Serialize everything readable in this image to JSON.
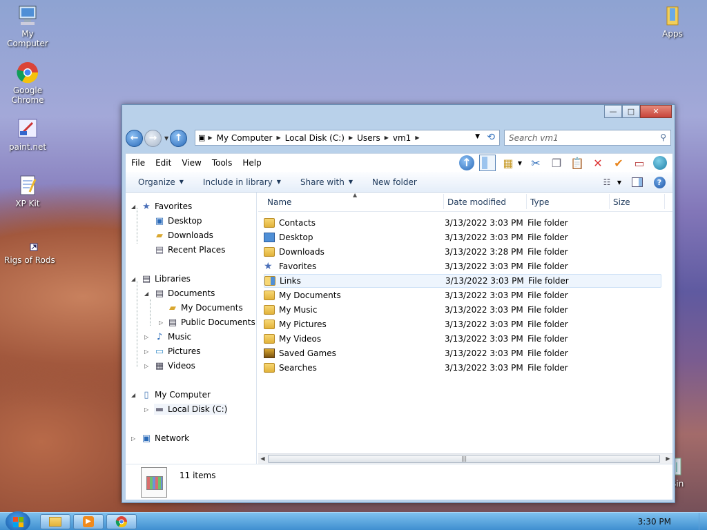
{
  "desktop": {
    "icons": [
      {
        "label": "My Computer",
        "icon": "computer-icon"
      },
      {
        "label": "Google Chrome",
        "icon": "chrome-icon"
      },
      {
        "label": "paint.net",
        "icon": "paintnet-icon"
      },
      {
        "label": "XP Kit",
        "icon": "document-icon"
      },
      {
        "label": "Rigs of Rods",
        "icon": "shortcut-icon"
      },
      {
        "label": "Apps",
        "icon": "folder-icon"
      },
      {
        "label": "e Bin",
        "icon": "recycle-bin-icon"
      }
    ]
  },
  "window": {
    "caption": {
      "minimize": "—",
      "maximize": "□",
      "close": "✕"
    },
    "address": {
      "crumbs": [
        "My Computer",
        "Local Disk (C:)",
        "Users",
        "vm1"
      ]
    },
    "search": {
      "placeholder": "Search vm1"
    },
    "menu": [
      "File",
      "Edit",
      "View",
      "Tools",
      "Help"
    ],
    "commands": {
      "organize": "Organize",
      "include_in_library": "Include in library",
      "share_with": "Share with",
      "new_folder": "New folder"
    },
    "nav_tree": {
      "favorites": "Favorites",
      "desktop": "Desktop",
      "downloads": "Downloads",
      "recent_places": "Recent Places",
      "libraries": "Libraries",
      "documents": "Documents",
      "my_documents": "My Documents",
      "public_documents": "Public Documents",
      "music": "Music",
      "pictures": "Pictures",
      "videos": "Videos",
      "my_computer": "My Computer",
      "local_disk": "Local Disk (C:)",
      "network": "Network"
    },
    "columns": {
      "name": "Name",
      "date_modified": "Date modified",
      "type": "Type",
      "size": "Size"
    },
    "files": [
      {
        "name": "Contacts",
        "date": "3/13/2022 3:03 PM",
        "type": "File folder"
      },
      {
        "name": "Desktop",
        "date": "3/13/2022 3:03 PM",
        "type": "File folder"
      },
      {
        "name": "Downloads",
        "date": "3/13/2022 3:28 PM",
        "type": "File folder"
      },
      {
        "name": "Favorites",
        "date": "3/13/2022 3:03 PM",
        "type": "File folder"
      },
      {
        "name": "Links",
        "date": "3/13/2022 3:03 PM",
        "type": "File folder"
      },
      {
        "name": "My Documents",
        "date": "3/13/2022 3:03 PM",
        "type": "File folder"
      },
      {
        "name": "My Music",
        "date": "3/13/2022 3:03 PM",
        "type": "File folder"
      },
      {
        "name": "My Pictures",
        "date": "3/13/2022 3:03 PM",
        "type": "File folder"
      },
      {
        "name": "My Videos",
        "date": "3/13/2022 3:03 PM",
        "type": "File folder"
      },
      {
        "name": "Saved Games",
        "date": "3/13/2022 3:03 PM",
        "type": "File folder"
      },
      {
        "name": "Searches",
        "date": "3/13/2022 3:03 PM",
        "type": "File folder"
      }
    ],
    "details": {
      "count": "11 items"
    }
  },
  "taskbar": {
    "clock": "3:30 PM"
  }
}
